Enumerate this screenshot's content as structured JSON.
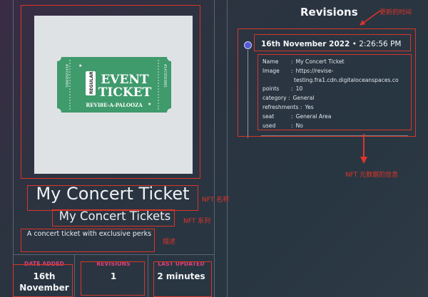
{
  "nft": {
    "name": "My Concert Ticket",
    "collection": "My Concert Tickets",
    "description": "A concert ticket with exclusive perks"
  },
  "ticket_art": {
    "line1": "EVENT",
    "line2": "TICKET",
    "badge": "REGULAR",
    "footer": "REVI8E-A-PALOOZA",
    "serial": "#1472583001",
    "color": "#3f9a6c"
  },
  "stats": [
    {
      "label": "DATE ADDED",
      "value": "16th",
      "extra": "November"
    },
    {
      "label": "REVISIONS",
      "value": "1"
    },
    {
      "label": "LAST UPDATED",
      "value": "2 minutes"
    }
  ],
  "revisions": {
    "title": "Revisions",
    "entry": {
      "date": "16th November 2022",
      "time": "2:26:56 PM",
      "fields": [
        {
          "key": "Name",
          "value": "My Concert Ticket"
        },
        {
          "key": "Image",
          "value": "https://revise-",
          "cont": "testing.fra1.cdn.digitaloceanspaces.co"
        },
        {
          "key": "points",
          "value": "10"
        },
        {
          "key": "category",
          "value": "General"
        },
        {
          "key": "refreshments",
          "value": "Yes"
        },
        {
          "key": "seat",
          "value": "General Area"
        },
        {
          "key": "used",
          "value": "No"
        }
      ]
    }
  },
  "annotations": {
    "update_time": "更新的时间",
    "metadata_info": "NFT 元数据的信息",
    "nft_name": "NFT 名称",
    "nft_series": "NFT 系列",
    "description": "描述"
  },
  "colors": {
    "annotation": "#d9352a",
    "accent_pink": "#e0407a",
    "timeline_dot": "#5658d8"
  }
}
